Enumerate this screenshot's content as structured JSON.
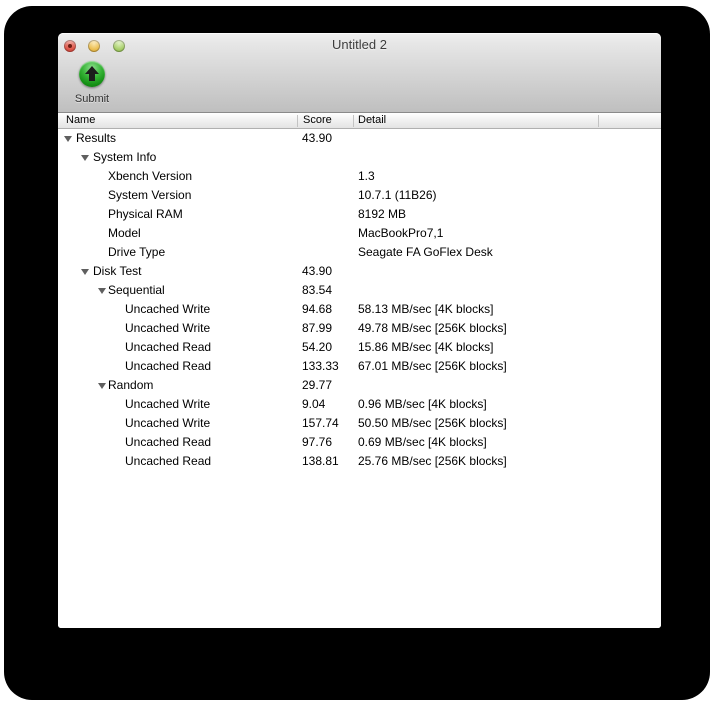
{
  "window": {
    "title": "Untitled 2",
    "controls": [
      "close",
      "minimize",
      "zoom"
    ],
    "close_has_unsaved_dot": true
  },
  "toolbar": {
    "submit_label": "Submit"
  },
  "colors": {
    "close_red": "#dd564a",
    "minimize_yellow": "#ecc054",
    "zoom_green": "#a9cf6c",
    "submit_green": "#2eb32e",
    "toolbar_gradient_top": "#f1f1f1",
    "toolbar_gradient_bottom": "#bfbfbf",
    "shadow_black": "#000000"
  },
  "table": {
    "columns": [
      "Name",
      "Score",
      "Detail"
    ],
    "rows": [
      {
        "level": 0,
        "expandable": true,
        "name": "Results",
        "score": "43.90",
        "detail": ""
      },
      {
        "level": 1,
        "expandable": true,
        "name": "System Info",
        "score": "",
        "detail": ""
      },
      {
        "level": 2,
        "expandable": false,
        "name": "Xbench Version",
        "score": "",
        "detail": "1.3"
      },
      {
        "level": 2,
        "expandable": false,
        "name": "System Version",
        "score": "",
        "detail": "10.7.1 (11B26)"
      },
      {
        "level": 2,
        "expandable": false,
        "name": "Physical RAM",
        "score": "",
        "detail": "8192 MB"
      },
      {
        "level": 2,
        "expandable": false,
        "name": "Model",
        "score": "",
        "detail": "MacBookPro7,1"
      },
      {
        "level": 2,
        "expandable": false,
        "name": "Drive Type",
        "score": "",
        "detail": "Seagate FA GoFlex Desk"
      },
      {
        "level": 1,
        "expandable": true,
        "name": "Disk Test",
        "score": "43.90",
        "detail": ""
      },
      {
        "level": 2,
        "expandable": true,
        "name": "Sequential",
        "score": "83.54",
        "detail": ""
      },
      {
        "level": 3,
        "expandable": false,
        "name": "Uncached Write",
        "score": "94.68",
        "detail": "58.13 MB/sec [4K blocks]"
      },
      {
        "level": 3,
        "expandable": false,
        "name": "Uncached Write",
        "score": "87.99",
        "detail": "49.78 MB/sec [256K blocks]"
      },
      {
        "level": 3,
        "expandable": false,
        "name": "Uncached Read",
        "score": "54.20",
        "detail": "15.86 MB/sec [4K blocks]"
      },
      {
        "level": 3,
        "expandable": false,
        "name": "Uncached Read",
        "score": "133.33",
        "detail": "67.01 MB/sec [256K blocks]"
      },
      {
        "level": 2,
        "expandable": true,
        "name": "Random",
        "score": "29.77",
        "detail": ""
      },
      {
        "level": 3,
        "expandable": false,
        "name": "Uncached Write",
        "score": "9.04",
        "detail": "0.96 MB/sec [4K blocks]"
      },
      {
        "level": 3,
        "expandable": false,
        "name": "Uncached Write",
        "score": "157.74",
        "detail": "50.50 MB/sec [256K blocks]"
      },
      {
        "level": 3,
        "expandable": false,
        "name": "Uncached Read",
        "score": "97.76",
        "detail": "0.69 MB/sec [4K blocks]"
      },
      {
        "level": 3,
        "expandable": false,
        "name": "Uncached Read",
        "score": "138.81",
        "detail": "25.76 MB/sec [256K blocks]"
      }
    ]
  }
}
